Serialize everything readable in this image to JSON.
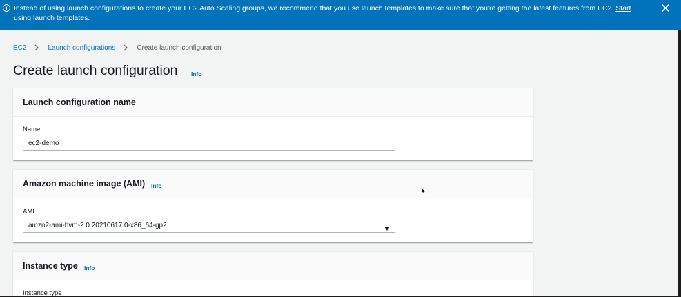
{
  "banner": {
    "icon": "info-circle-icon",
    "text": "Instead of using launch configurations to create your EC2 Auto Scaling groups, we recommend that you use launch templates to make sure that you're getting the latest features from EC2.",
    "link_text": "Start using launch templates.",
    "close_icon": "close-icon",
    "background": "#0073bb"
  },
  "breadcrumb": {
    "items": [
      "EC2",
      "Launch configurations"
    ],
    "current": "Create launch configuration"
  },
  "page": {
    "title": "Create launch configuration",
    "info": "Info"
  },
  "panels": {
    "name": {
      "title": "Launch configuration name",
      "field_label": "Name",
      "field_value": "ec2-demo"
    },
    "ami": {
      "title": "Amazon machine image (AMI)",
      "info": "Info",
      "field_label": "AMI",
      "selected_value": "amzn2-ami-hvm-2.0.20210617.0-x86_64-gp2"
    },
    "instance_type": {
      "title": "Instance type",
      "info": "Info",
      "field_label": "Instance type"
    }
  },
  "colors": {
    "link": "#0073bb",
    "background": "#f2f3f3",
    "panel_header": "#fafafa"
  }
}
